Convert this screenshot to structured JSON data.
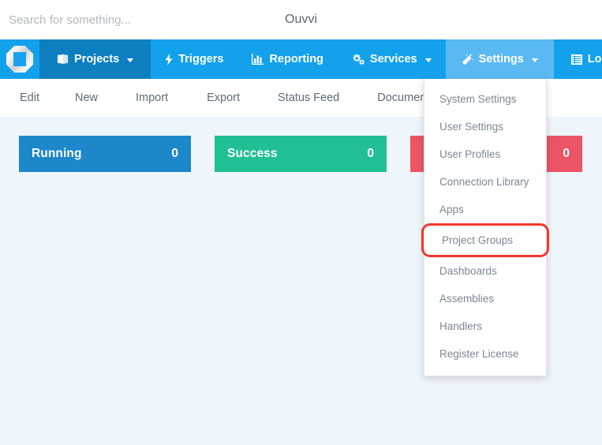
{
  "header": {
    "search_placeholder": "Search for something...",
    "search_value": "",
    "brand": "Ouvvi"
  },
  "navbar": {
    "logo_icon": "ouvvi-octagon-logo",
    "items": [
      {
        "label": "Projects",
        "icon": "book-icon",
        "has_caret": true,
        "state": "open"
      },
      {
        "label": "Triggers",
        "icon": "bolt-icon",
        "has_caret": false,
        "state": "normal"
      },
      {
        "label": "Reporting",
        "icon": "bar-chart-icon",
        "has_caret": false,
        "state": "normal"
      },
      {
        "label": "Services",
        "icon": "gears-icon",
        "has_caret": true,
        "state": "normal"
      },
      {
        "label": "Settings",
        "icon": "magic-wand-icon",
        "has_caret": true,
        "state": "active"
      },
      {
        "label": "Log",
        "icon": "list-icon",
        "has_caret": false,
        "state": "normal"
      }
    ],
    "colors": {
      "bar": "#14a1ec",
      "projects_bg": "#0d7fbf",
      "settings_active_bg": "#5bb9f2"
    }
  },
  "subnav": {
    "items": [
      {
        "label": "Edit"
      },
      {
        "label": "New"
      },
      {
        "label": "Import"
      },
      {
        "label": "Export"
      },
      {
        "label": "Status Feed"
      },
      {
        "label": "Documentation"
      }
    ]
  },
  "status_cards": [
    {
      "label": "Running",
      "value": "0",
      "color": "#1c87c9"
    },
    {
      "label": "Success",
      "value": "0",
      "color": "#21bf96"
    },
    {
      "label": "",
      "value": "0",
      "color": "#ec5565"
    }
  ],
  "settings_dropdown": {
    "open": true,
    "highlight_color": "#f0382c",
    "items": [
      {
        "label": "System Settings",
        "highlighted": false
      },
      {
        "label": "User Settings",
        "highlighted": false
      },
      {
        "label": "User Profiles",
        "highlighted": false
      },
      {
        "label": "Connection Library",
        "highlighted": false
      },
      {
        "label": "Apps",
        "highlighted": false
      },
      {
        "label": "Project Groups",
        "highlighted": true
      },
      {
        "label": "Dashboards",
        "highlighted": false
      },
      {
        "label": "Assemblies",
        "highlighted": false
      },
      {
        "label": "Handlers",
        "highlighted": false
      },
      {
        "label": "Register License",
        "highlighted": false
      }
    ]
  }
}
